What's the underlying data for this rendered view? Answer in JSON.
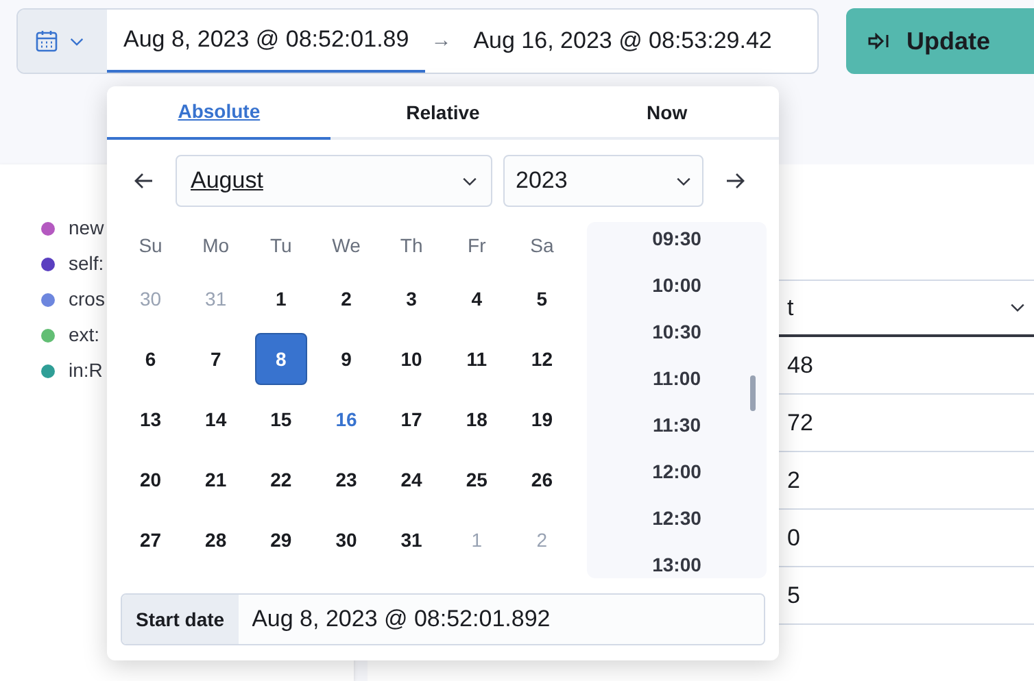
{
  "date_picker": {
    "start": "Aug 8, 2023 @ 08:52:01.89",
    "arrow": "→",
    "end": "Aug 16, 2023 @ 08:53:29.42",
    "start_selected": true
  },
  "update_button": {
    "label": "Update"
  },
  "legend": [
    {
      "label": "new",
      "color": "#b459c0"
    },
    {
      "label": "self:",
      "color": "#5a3fc0"
    },
    {
      "label": "cros",
      "color": "#6d86de"
    },
    {
      "label": "ext:",
      "color": "#62be74"
    },
    {
      "label": "in:R",
      "color": "#2f9e96"
    }
  ],
  "table": {
    "column_header": "t",
    "rows": [
      "48",
      "72",
      "2",
      "0",
      "5"
    ]
  },
  "popover": {
    "tabs": [
      {
        "label": "Absolute",
        "selected": true
      },
      {
        "label": "Relative",
        "selected": false
      },
      {
        "label": "Now",
        "selected": false
      }
    ],
    "month": "August",
    "year": "2023",
    "weekdays": [
      "Su",
      "Mo",
      "Tu",
      "We",
      "Th",
      "Fr",
      "Sa"
    ],
    "weeks": [
      [
        {
          "label": "30",
          "kind": "outside",
          "selected": false
        },
        {
          "label": "31",
          "kind": "outside",
          "selected": false
        },
        {
          "label": "1",
          "kind": "current",
          "selected": false
        },
        {
          "label": "2",
          "kind": "current",
          "selected": false
        },
        {
          "label": "3",
          "kind": "current",
          "selected": false
        },
        {
          "label": "4",
          "kind": "current",
          "selected": false
        },
        {
          "label": "5",
          "kind": "current",
          "selected": false
        }
      ],
      [
        {
          "label": "6",
          "kind": "current",
          "selected": false
        },
        {
          "label": "7",
          "kind": "current",
          "selected": false
        },
        {
          "label": "8",
          "kind": "current",
          "selected": true
        },
        {
          "label": "9",
          "kind": "current",
          "selected": false
        },
        {
          "label": "10",
          "kind": "current",
          "selected": false
        },
        {
          "label": "11",
          "kind": "current",
          "selected": false
        },
        {
          "label": "12",
          "kind": "current",
          "selected": false
        }
      ],
      [
        {
          "label": "13",
          "kind": "current",
          "selected": false
        },
        {
          "label": "14",
          "kind": "current",
          "selected": false
        },
        {
          "label": "15",
          "kind": "current",
          "selected": false
        },
        {
          "label": "16",
          "kind": "today",
          "selected": false
        },
        {
          "label": "17",
          "kind": "current",
          "selected": false
        },
        {
          "label": "18",
          "kind": "current",
          "selected": false
        },
        {
          "label": "19",
          "kind": "current",
          "selected": false
        }
      ],
      [
        {
          "label": "20",
          "kind": "current",
          "selected": false
        },
        {
          "label": "21",
          "kind": "current",
          "selected": false
        },
        {
          "label": "22",
          "kind": "current",
          "selected": false
        },
        {
          "label": "23",
          "kind": "current",
          "selected": false
        },
        {
          "label": "24",
          "kind": "current",
          "selected": false
        },
        {
          "label": "25",
          "kind": "current",
          "selected": false
        },
        {
          "label": "26",
          "kind": "current",
          "selected": false
        }
      ],
      [
        {
          "label": "27",
          "kind": "current",
          "selected": false
        },
        {
          "label": "28",
          "kind": "current",
          "selected": false
        },
        {
          "label": "29",
          "kind": "current",
          "selected": false
        },
        {
          "label": "30",
          "kind": "current",
          "selected": false
        },
        {
          "label": "31",
          "kind": "current",
          "selected": false
        },
        {
          "label": "1",
          "kind": "outside",
          "selected": false
        },
        {
          "label": "2",
          "kind": "outside",
          "selected": false
        }
      ]
    ],
    "times": [
      "09:30",
      "10:00",
      "10:30",
      "11:00",
      "11:30",
      "12:00",
      "12:30",
      "13:00"
    ],
    "start_label": "Start date",
    "start_value": "Aug 8, 2023 @ 08:52:01.892"
  }
}
